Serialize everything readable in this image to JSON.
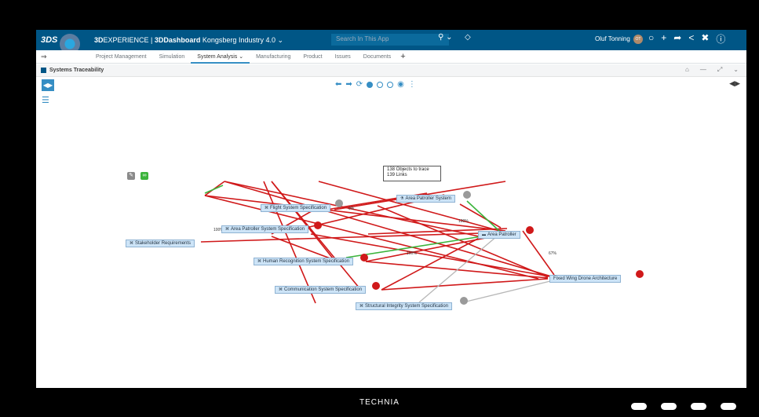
{
  "topbar": {
    "logo": "3DS",
    "brand_prefix": "3D",
    "brand_rest": "EXPERIENCE | ",
    "app": "3DDashboard",
    "context": "Kongsberg Industry 4.0 ⌄",
    "search_placeholder": "Search In This App",
    "user": "Oluf Tonning",
    "avatar_initials": "OT"
  },
  "tabs": [
    {
      "label": "Project Management"
    },
    {
      "label": "Simulation"
    },
    {
      "label": "System Analysis  ⌄"
    },
    {
      "label": "Manufacturing"
    },
    {
      "label": "Product"
    },
    {
      "label": "Issues"
    },
    {
      "label": "Documents"
    }
  ],
  "widget": {
    "title": "Systems Traceability"
  },
  "stats": {
    "objects": "138 Objects to trace",
    "links": "139 Links"
  },
  "nodes": {
    "flight": "Flight System Specification",
    "area_patroller_system": "Area Patroller System",
    "area_patroller_spec": "Area Patroller System Specification",
    "area_patroller": "Area Patroller",
    "stakeholder": "Stakeholder Requirements",
    "human": "Human Recognition System Specification",
    "fixed_wing": "Fixed Wing Drone Architecture",
    "communication": "Communication System Specification",
    "structural": "Structural Integrity System Specification"
  },
  "edge_labels": {
    "l1": "0%",
    "l2": "100%",
    "l3": "100%",
    "l4": "100%",
    "l5": "67%"
  },
  "footer": {
    "brand": "TECHNIA"
  },
  "colors": {
    "accent": "#005686",
    "link_red": "#d0191a",
    "link_green": "#3cb43c",
    "link_grey": "#b7b7b7"
  }
}
